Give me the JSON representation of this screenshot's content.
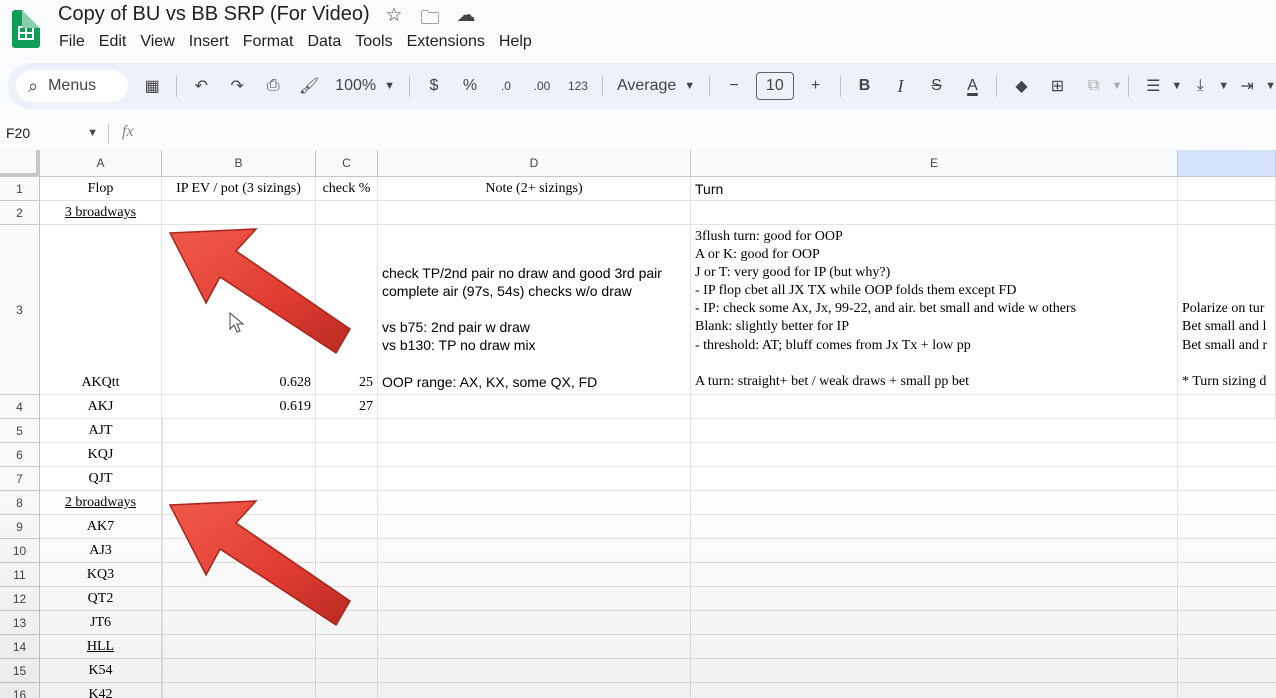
{
  "window": {
    "doc_title": "Copy of BU vs BB SRP (For Video)",
    "title_icons": [
      "star-icon",
      "move-to-folder-icon",
      "cloud-status-icon"
    ]
  },
  "menubar": {
    "items": [
      "File",
      "Edit",
      "View",
      "Insert",
      "Format",
      "Data",
      "Tools",
      "Extensions",
      "Help"
    ]
  },
  "toolbar": {
    "search_label": "Menus",
    "zoom": "100%",
    "currency": "$",
    "percent": "%",
    "decrease_decimal": ".0",
    "increase_decimal": ".00",
    "number_format": "123",
    "font_name": "Average",
    "font_size": "10",
    "minus": "−",
    "plus": "+",
    "bold": "B",
    "italic": "I",
    "strike": "S",
    "text_color": "A"
  },
  "formula_bar": {
    "name_box": "F20",
    "fx_label": "fx"
  },
  "columns": [
    {
      "label": "A"
    },
    {
      "label": "B"
    },
    {
      "label": "C"
    },
    {
      "label": "D"
    },
    {
      "label": "E"
    },
    {
      "label": ""
    }
  ],
  "rows": [
    "1",
    "2",
    "3",
    "4",
    "5",
    "6",
    "7",
    "8",
    "9",
    "10",
    "11",
    "12",
    "13",
    "14",
    "15",
    "16"
  ],
  "cells": {
    "A1": "Flop",
    "B1": "IP EV / pot (3 sizings)",
    "C1": "check %",
    "D1": "Note (2+ sizings)",
    "E1": "Turn",
    "A2": "3 broadways",
    "A3": "AKQtt",
    "B3": "0.628",
    "C3": "25",
    "D3": "check TP/2nd pair no draw and good 3rd pair\ncomplete air (97s, 54s) checks w/o draw\n\nvs b75: 2nd pair w draw\nvs b130: TP no draw mix\n\nOOP range: AX, KX, some QX, FD",
    "E3": "3flush turn: good for OOP\nA or K: good for OOP\nJ or T: very good for IP (but why?)\n- IP flop cbet all JX TX while OOP folds them except FD\n- IP: check some Ax, Jx, 99-22, and air. bet small and wide w others\nBlank: slightly better for IP\n- threshold: AT; bluff comes from Jx Tx + low pp\n\nA turn: straight+ bet / weak draws + small pp bet",
    "F3": "\n\n\n\nPolarize on tur\nBet small and l\nBet small and r\n\n* Turn sizing d",
    "A4": "AKJ",
    "B4": "0.619",
    "C4": "27",
    "A5": "AJT",
    "A6": "KQJ",
    "A7": "QJT",
    "A8": "2 broadways",
    "A9": "AK7",
    "A10": "AJ3",
    "A11": "KQ3",
    "A12": "QT2",
    "A13": "JT6",
    "A14": "HLL",
    "A15": "K54",
    "A16": "K42"
  },
  "colors": {
    "sheets_green": "#0f9d58",
    "toolbar_bg": "#edf2fa",
    "selected_header": "#d3e3fd",
    "arrow_red": "#e03c31"
  }
}
